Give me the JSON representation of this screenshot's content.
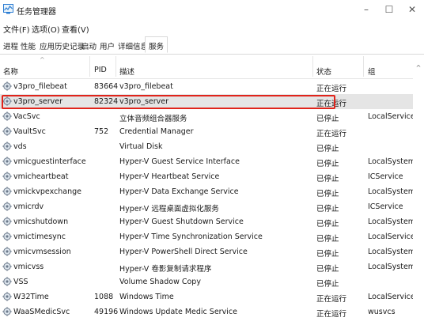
{
  "window": {
    "title": "任务管理器",
    "min_glyph": "–",
    "max_glyph": "☐",
    "close_glyph": "✕"
  },
  "menu": [
    "文件(F)",
    "选项(O)",
    "查看(V)"
  ],
  "tabs": [
    "进程",
    "性能",
    "应用历史记录",
    "启动",
    "用户",
    "详细信息",
    "服务"
  ],
  "active_tab": "服务",
  "columns": {
    "name": "名称",
    "pid": "PID",
    "description": "描述",
    "status": "状态",
    "group": "组",
    "sort_glyph": "^"
  },
  "rows": [
    {
      "name": "v3pro_filebeat",
      "pid": "83664",
      "description": "v3pro_filebeat",
      "status": "正在运行",
      "group": ""
    },
    {
      "name": "v3pro_server",
      "pid": "82324",
      "description": "v3pro_server",
      "status": "正在运行",
      "group": ""
    },
    {
      "name": "VacSvc",
      "pid": "",
      "description": "立体音频组合器服务",
      "status": "已停止",
      "group": "LocalService..."
    },
    {
      "name": "VaultSvc",
      "pid": "752",
      "description": "Credential Manager",
      "status": "正在运行",
      "group": ""
    },
    {
      "name": "vds",
      "pid": "",
      "description": "Virtual Disk",
      "status": "已停止",
      "group": ""
    },
    {
      "name": "vmicguestinterface",
      "pid": "",
      "description": "Hyper-V Guest Service Interface",
      "status": "已停止",
      "group": "LocalSystem..."
    },
    {
      "name": "vmicheartbeat",
      "pid": "",
      "description": "Hyper-V Heartbeat Service",
      "status": "已停止",
      "group": "ICService"
    },
    {
      "name": "vmickvpexchange",
      "pid": "",
      "description": "Hyper-V Data Exchange Service",
      "status": "已停止",
      "group": "LocalSystem..."
    },
    {
      "name": "vmicrdv",
      "pid": "",
      "description": "Hyper-V 远程桌面虚拟化服务",
      "status": "已停止",
      "group": "ICService"
    },
    {
      "name": "vmicshutdown",
      "pid": "",
      "description": "Hyper-V Guest Shutdown Service",
      "status": "已停止",
      "group": "LocalSystem..."
    },
    {
      "name": "vmictimesync",
      "pid": "",
      "description": "Hyper-V Time Synchronization Service",
      "status": "已停止",
      "group": "LocalService..."
    },
    {
      "name": "vmicvmsession",
      "pid": "",
      "description": "Hyper-V PowerShell Direct Service",
      "status": "已停止",
      "group": "LocalSystem..."
    },
    {
      "name": "vmicvss",
      "pid": "",
      "description": "Hyper-V 卷影复制请求程序",
      "status": "已停止",
      "group": "LocalSystem..."
    },
    {
      "name": "VSS",
      "pid": "",
      "description": "Volume Shadow Copy",
      "status": "已停止",
      "group": ""
    },
    {
      "name": "W32Time",
      "pid": "1088",
      "description": "Windows Time",
      "status": "正在运行",
      "group": "LocalService"
    },
    {
      "name": "WaaSMedicSvc",
      "pid": "49196",
      "description": "Windows Update Medic Service",
      "status": "正在运行",
      "group": "wusvcs"
    }
  ],
  "selected_row_index": 1,
  "colors": {
    "highlight_border": "#e0241b",
    "selected_row_bg": "#e5e5e5"
  }
}
